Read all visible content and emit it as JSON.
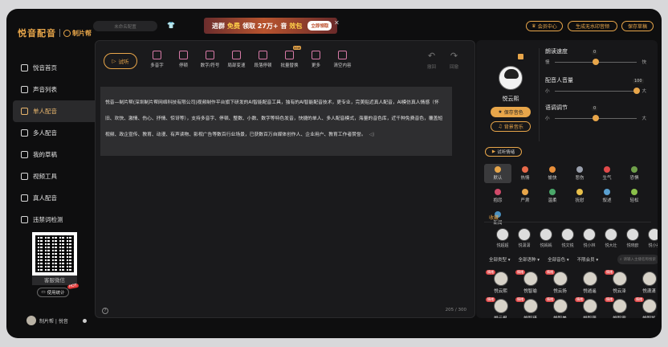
{
  "brand": {
    "name": "悦音配音",
    "sub_name": "制片帮"
  },
  "nav": [
    {
      "label": "悦音首页",
      "icon": "home-icon"
    },
    {
      "label": "声音列表",
      "icon": "list-icon"
    },
    {
      "label": "单人配音",
      "icon": "user-icon",
      "active": true
    },
    {
      "label": "多人配音",
      "icon": "users-icon"
    },
    {
      "label": "我的草稿",
      "icon": "draft-icon"
    },
    {
      "label": "视频工具",
      "icon": "video-icon"
    },
    {
      "label": "真人配音",
      "icon": "mic-icon"
    },
    {
      "label": "违禁词检测",
      "icon": "shield-icon"
    }
  ],
  "service": {
    "caption": "客服微信",
    "stats_label": "使用统计",
    "hot_badge": "HOT"
  },
  "user": {
    "name": "制片帮 | 悦音"
  },
  "topbar": {
    "draft_placeholder": "未命名配置",
    "banner": {
      "prefix": "进群",
      "highlight": "免费",
      "middle": "领取 27万+ 音",
      "highlight2": "效包",
      "button": "立即领取"
    },
    "member_center": "会员中心",
    "make_watermark_free": "生成无水印音频",
    "save_draft": "保存草稿"
  },
  "editor": {
    "audition_label": "试听",
    "tools": [
      {
        "label": "多音字",
        "icon": "polyphone-icon"
      },
      {
        "label": "停顿",
        "icon": "pause-icon"
      },
      {
        "label": "数字/符号",
        "icon": "hash-icon"
      },
      {
        "label": "局部变速",
        "icon": "speed-icon"
      },
      {
        "label": "段落停顿",
        "icon": "paragraph-pause-icon"
      },
      {
        "label": "批量替换",
        "icon": "replace-icon",
        "badge": "new"
      },
      {
        "label": "更多",
        "icon": "more-icon"
      },
      {
        "label": "清空内容",
        "icon": "clear-icon"
      }
    ],
    "undo_label": "撤回",
    "redo_label": "回撤",
    "text": "悦音—制片帮(深圳制片帮网络科技有限公司)视频制作平台旗下研发的AI智能配音工具，独有的AI智能配音技术，更专业，完美贴近真人配音，AI模仿真人情感（怀旧、欢快、激情、伤心、抒情、惊讶等），支持多音字、停顿、整数、小数、数字等特色发音，快捷的单人、多人配音模式，海量的音色库，近千种免费音色，覆盖短视频、政企宣传、教育、动漫、有声读物、影视广告等数百行业场景，已获数百万自媒体创作人、企业用户、教育工作者赞誉。",
    "counter": "205 / 300"
  },
  "voice_panel": {
    "voice_name": "悦云熙",
    "save_voice": "保存音色",
    "bg_music": "背景音乐",
    "sliders": [
      {
        "title": "朗读速度",
        "lo": "慢",
        "hi": "快",
        "value": "0",
        "fraction": 0.5
      },
      {
        "title": "配音人音量",
        "lo": "小",
        "hi": "大",
        "value": "100",
        "fraction": 1.0
      },
      {
        "title": "语调调节",
        "lo": "小",
        "hi": "大",
        "value": "0",
        "fraction": 0.5
      }
    ],
    "emotion_button": "试听情绪",
    "emotions": [
      {
        "label": "默认",
        "color": "#e8a64a",
        "selected": true
      },
      {
        "label": "热情",
        "color": "#e86a4a"
      },
      {
        "label": "愉快",
        "color": "#e88f3a"
      },
      {
        "label": "悲伤",
        "color": "#9aa0ad"
      },
      {
        "label": "生气",
        "color": "#e14a4a"
      },
      {
        "label": "恐惧",
        "color": "#6fa04a"
      },
      {
        "label": "抱怨",
        "color": "#d04a6a"
      },
      {
        "label": "严肃",
        "color": "#e8a64a"
      },
      {
        "label": "温柔",
        "color": "#4aa86a"
      },
      {
        "label": "抚慰",
        "color": "#e8c04a"
      },
      {
        "label": "叙述",
        "color": "#5aa0d0"
      },
      {
        "label": "轻松",
        "color": "#8ac04a"
      },
      {
        "label": "新闻",
        "color": "#4a90c0"
      }
    ],
    "favorites_title": "收藏",
    "favorites": [
      "悦超超",
      "悦潇潇",
      "悦嫣嫣",
      "悦文锐",
      "悦小林",
      "悦大壮",
      "悦晓欧",
      "悦小美"
    ],
    "filters": [
      "全部类型",
      "全部语种",
      "全部音色",
      "不限会员"
    ],
    "search_placeholder": "请输入主播名称搜索",
    "voices": [
      {
        "name": "悦云熙",
        "tag": "情绪"
      },
      {
        "name": "悦智瑜",
        "tag": "情绪"
      },
      {
        "name": "悦云扬",
        "tag": "情绪"
      },
      {
        "name": "悦逍遥",
        "tag": ""
      },
      {
        "name": "悦云泽",
        "tag": "情绪"
      },
      {
        "name": "悦潇潇",
        "tag": ""
      },
      {
        "name": "悦云枫",
        "tag": "情绪"
      },
      {
        "name": "悦智瑾",
        "tag": "情绪"
      },
      {
        "name": "悦智美",
        "tag": "情绪"
      },
      {
        "name": "悦智萌",
        "tag": "情绪"
      },
      {
        "name": "悦智霞",
        "tag": "情绪"
      },
      {
        "name": "悦智凯",
        "tag": "情绪"
      }
    ]
  }
}
